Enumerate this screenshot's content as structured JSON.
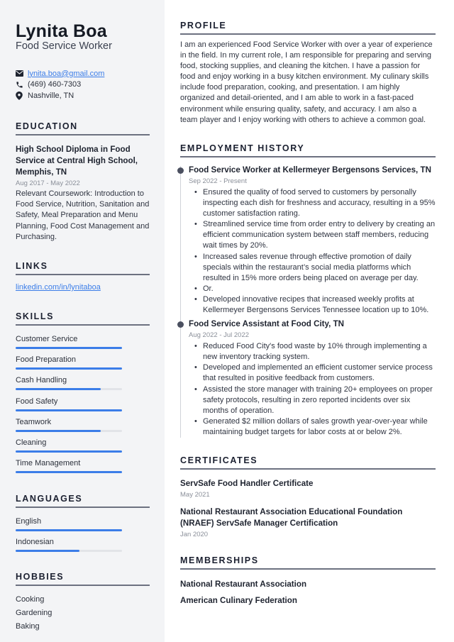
{
  "header": {
    "name": "Lynita Boa",
    "title": "Food Service Worker"
  },
  "contact": {
    "email": "lynita.boa@gmail.com",
    "phone": "(469) 460-7303",
    "location": "Nashville, TN",
    "icons": [
      "envelope-icon",
      "phone-icon",
      "map-pin-icon"
    ]
  },
  "education": {
    "heading": "EDUCATION",
    "title": "High School Diploma in Food Service at Central High School, Memphis, TN",
    "date": "Aug 2017 - May 2022",
    "description": "Relevant Coursework: Introduction to Food Service, Nutrition, Sanitation and Safety, Meal Preparation and Menu Planning, Food Cost Management and Purchasing."
  },
  "links": {
    "heading": "LINKS",
    "items": [
      {
        "label": "linkedin.com/in/lynitaboa"
      }
    ]
  },
  "skills": {
    "heading": "SKILLS",
    "accent_color": "#3b7de8",
    "items": [
      {
        "label": "Customer Service",
        "level": 1.0
      },
      {
        "label": "Food Preparation",
        "level": 1.0
      },
      {
        "label": "Cash Handling",
        "level": 0.8
      },
      {
        "label": "Food Safety",
        "level": 1.0
      },
      {
        "label": "Teamwork",
        "level": 0.8
      },
      {
        "label": "Cleaning",
        "level": 1.0
      },
      {
        "label": "Time Management",
        "level": 1.0
      }
    ]
  },
  "languages": {
    "heading": "LANGUAGES",
    "items": [
      {
        "label": "English",
        "level": 1.0
      },
      {
        "label": "Indonesian",
        "level": 0.6
      }
    ]
  },
  "hobbies": {
    "heading": "HOBBIES",
    "items": [
      "Cooking",
      "Gardening",
      "Baking"
    ]
  },
  "profile": {
    "heading": "PROFILE",
    "text": "I am an experienced Food Service Worker with over a year of experience in the field. In my current role, I am responsible for preparing and serving food, stocking supplies, and cleaning the kitchen. I have a passion for food and enjoy working in a busy kitchen environment. My culinary skills include food preparation, cooking, and presentation. I am highly organized and detail-oriented, and I am able to work in a fast-paced environment while ensuring quality, safety, and accuracy. I am also a team player and I enjoy working with others to achieve a common goal."
  },
  "employment": {
    "heading": "EMPLOYMENT HISTORY",
    "jobs": [
      {
        "title": "Food Service Worker at Kellermeyer Bergensons Services, TN",
        "date": "Sep 2022 - Present",
        "bullets": [
          "Ensured the quality of food served to customers by personally inspecting each dish for freshness and accuracy, resulting in a 95% customer satisfaction rating.",
          "Streamlined service time from order entry to delivery by creating an efficient communication system between staff members, reducing wait times by 20%.",
          "Increased sales revenue through effective promotion of daily specials within the restaurant’s social media platforms which resulted in 15% more orders being placed on average per day.",
          "Or.",
          "Developed innovative recipes that increased weekly profits at Kellermeyer Bergensons Services Tennessee location up to 10%."
        ]
      },
      {
        "title": "Food Service Assistant at Food City, TN",
        "date": "Aug 2022 - Jul 2022",
        "bullets": [
          "Reduced Food City's food waste by 10% through implementing a new inventory tracking system.",
          "Developed and implemented an efficient customer service process that resulted in positive feedback from customers.",
          "Assisted the store manager with training 20+ employees on proper safety protocols, resulting in zero reported incidents over six months of operation.",
          "Generated $2 million dollars of sales growth year-over-year while maintaining budget targets for labor costs at or below 2%."
        ]
      }
    ]
  },
  "certificates": {
    "heading": "CERTIFICATES",
    "items": [
      {
        "name": "ServSafe Food Handler Certificate",
        "date": "May 2021"
      },
      {
        "name": "National Restaurant Association Educational Foundation (NRAEF) ServSafe Manager Certification",
        "date": "Jan 2020"
      }
    ]
  },
  "memberships": {
    "heading": "MEMBERSHIPS",
    "items": [
      "National Restaurant Association",
      "American Culinary Federation"
    ]
  }
}
